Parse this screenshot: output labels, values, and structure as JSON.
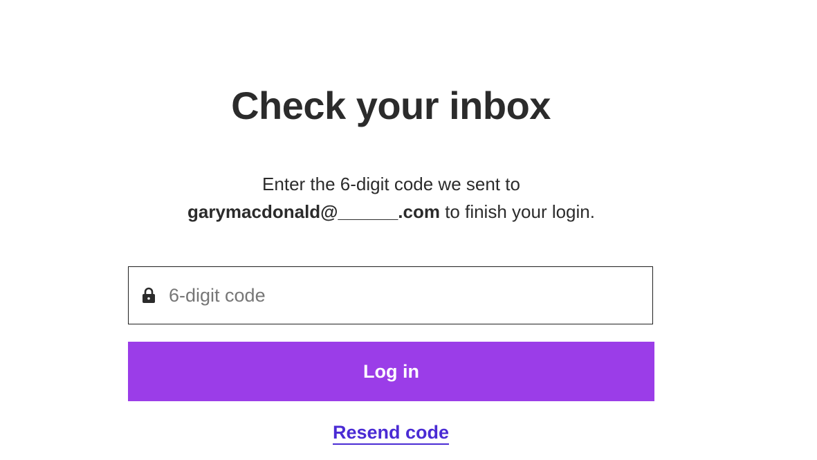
{
  "heading": {
    "title": "Check your inbox"
  },
  "instructions": {
    "line1": "Enter the 6-digit code we sent to",
    "email": "garymacdonald@______.com",
    "line2_suffix": " to finish your login."
  },
  "code_field": {
    "icon": "lock-icon",
    "value": "",
    "placeholder": "6-digit code"
  },
  "login_button": {
    "label": "Log in",
    "color": "#9b3de8"
  },
  "resend": {
    "label": "Resend code",
    "color": "#4a2bd4"
  }
}
